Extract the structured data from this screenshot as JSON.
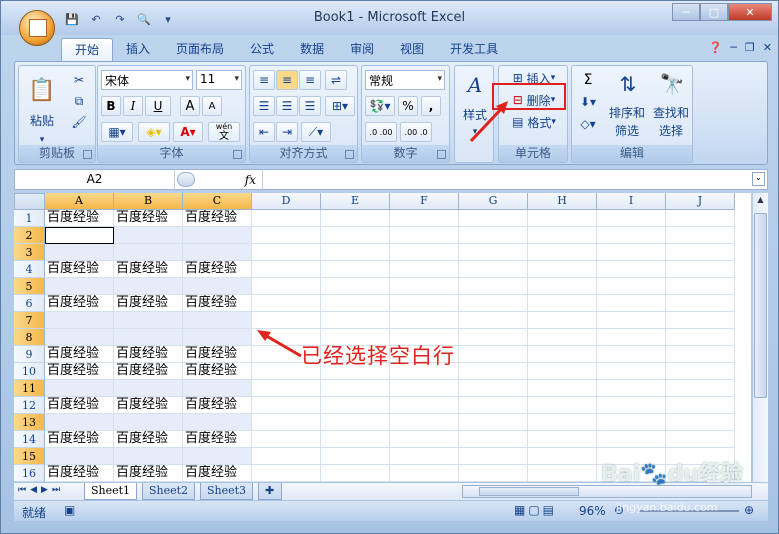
{
  "window": {
    "title": "Book1 - Microsoft Excel"
  },
  "qat": {
    "save": "save-icon",
    "undo": "undo-icon",
    "redo": "redo-icon",
    "preview": "print-preview-icon",
    "more": "▾"
  },
  "window_buttons": {
    "minimize": "─",
    "maximize": "□",
    "close": "✕"
  },
  "tabs": [
    "开始",
    "插入",
    "页面布局",
    "公式",
    "数据",
    "审阅",
    "视图",
    "开发工具"
  ],
  "ribbon": {
    "clipboard": {
      "paste": "粘贴",
      "label": "剪贴板"
    },
    "font": {
      "name": "宋体",
      "size": "11",
      "bold": "B",
      "italic": "I",
      "underline": "U",
      "grow": "A",
      "shrink": "A",
      "label": "字体",
      "wen": "wén",
      "wen_char": "文"
    },
    "alignment": {
      "label": "对齐方式"
    },
    "number": {
      "format": "常规",
      "percent": "%",
      "comma": ",",
      "inc": ".0 .00",
      "dec": ".00 .0",
      "label": "数字"
    },
    "styles": {
      "label": "样式"
    },
    "cells": {
      "insert": "插入",
      "delete": "删除",
      "format": "格式",
      "label": "单元格"
    },
    "editing": {
      "sigma": "Σ",
      "sort": "排序和",
      "sort2": "筛选",
      "find": "查找和",
      "find2": "选择",
      "label": "编辑"
    }
  },
  "formula_bar": {
    "name_box": "A2",
    "fx": "fx",
    "content": ""
  },
  "columns": [
    "A",
    "B",
    "C",
    "D",
    "E",
    "F",
    "G",
    "H",
    "I",
    "J"
  ],
  "rows": [
    {
      "n": "1",
      "cells": [
        "百度经验",
        "百度经验",
        "百度经验"
      ],
      "selected": false
    },
    {
      "n": "2",
      "cells": [
        "",
        "",
        ""
      ],
      "selected": true
    },
    {
      "n": "3",
      "cells": [
        "",
        "",
        ""
      ],
      "selected": true
    },
    {
      "n": "4",
      "cells": [
        "百度经验",
        "百度经验",
        "百度经验"
      ],
      "selected": false
    },
    {
      "n": "5",
      "cells": [
        "",
        "",
        ""
      ],
      "selected": true
    },
    {
      "n": "6",
      "cells": [
        "百度经验",
        "百度经验",
        "百度经验"
      ],
      "selected": false
    },
    {
      "n": "7",
      "cells": [
        "",
        "",
        ""
      ],
      "selected": true
    },
    {
      "n": "8",
      "cells": [
        "",
        "",
        ""
      ],
      "selected": true
    },
    {
      "n": "9",
      "cells": [
        "百度经验",
        "百度经验",
        "百度经验"
      ],
      "selected": false
    },
    {
      "n": "10",
      "cells": [
        "百度经验",
        "百度经验",
        "百度经验"
      ],
      "selected": false
    },
    {
      "n": "11",
      "cells": [
        "",
        "",
        ""
      ],
      "selected": true
    },
    {
      "n": "12",
      "cells": [
        "百度经验",
        "百度经验",
        "百度经验"
      ],
      "selected": false
    },
    {
      "n": "13",
      "cells": [
        "",
        "",
        ""
      ],
      "selected": true
    },
    {
      "n": "14",
      "cells": [
        "百度经验",
        "百度经验",
        "百度经验"
      ],
      "selected": false
    },
    {
      "n": "15",
      "cells": [
        "",
        "",
        ""
      ],
      "selected": true
    },
    {
      "n": "16",
      "cells": [
        "百度经验",
        "百度经验",
        "百度经验"
      ],
      "selected": false
    }
  ],
  "sheets": [
    "Sheet1",
    "Sheet2",
    "Sheet3"
  ],
  "status": {
    "ready": "就绪",
    "zoom": "96%"
  },
  "annotation": "已经选择空白行",
  "watermark": "Baidu经验 jingyan.baidu.com",
  "colors": {
    "selection_header": "#f5b748",
    "annotation": "#e0231c",
    "selected_fill": "#e6ecf8"
  }
}
